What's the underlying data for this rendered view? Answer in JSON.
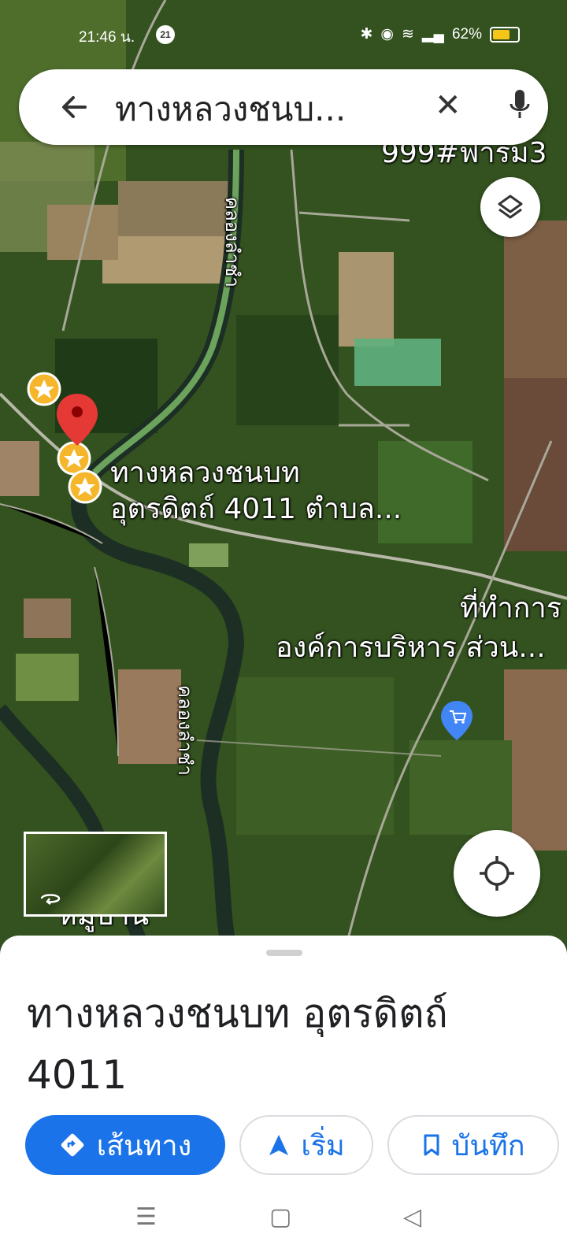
{
  "status_bar": {
    "time": "21:46 น.",
    "notification_count": "21",
    "battery": "62%",
    "battery_level": 0.62
  },
  "search": {
    "query": "ทางหลวงชนบ...",
    "clear_icon": "close-icon",
    "back_icon": "arrow-back-icon",
    "mic_icon": "mic-icon"
  },
  "map": {
    "labels": {
      "shop_top": "999#ฟาร์ม3",
      "canal_top": "คลองลำชำ",
      "road_line1": "ทางหลวงชนบท",
      "road_line2": "อุตรดิตถ์ 4011 ตำบล...",
      "office_line1": "ที่ทำการ",
      "office_line2": "องค์การบริหาร ส่วน...",
      "canal_bottom": "คลองลำชำ",
      "village": "หมู่บ้าน"
    },
    "accent": "#1a73e8",
    "pin_color": "#e53935",
    "star_color": "#f6b62b"
  },
  "place": {
    "title": "ทางหลวงชนบท อุตรดิตถ์ 4011"
  },
  "actions": {
    "directions": "เส้นทาง",
    "start": "เริ่ม",
    "save": "บันทึก"
  }
}
